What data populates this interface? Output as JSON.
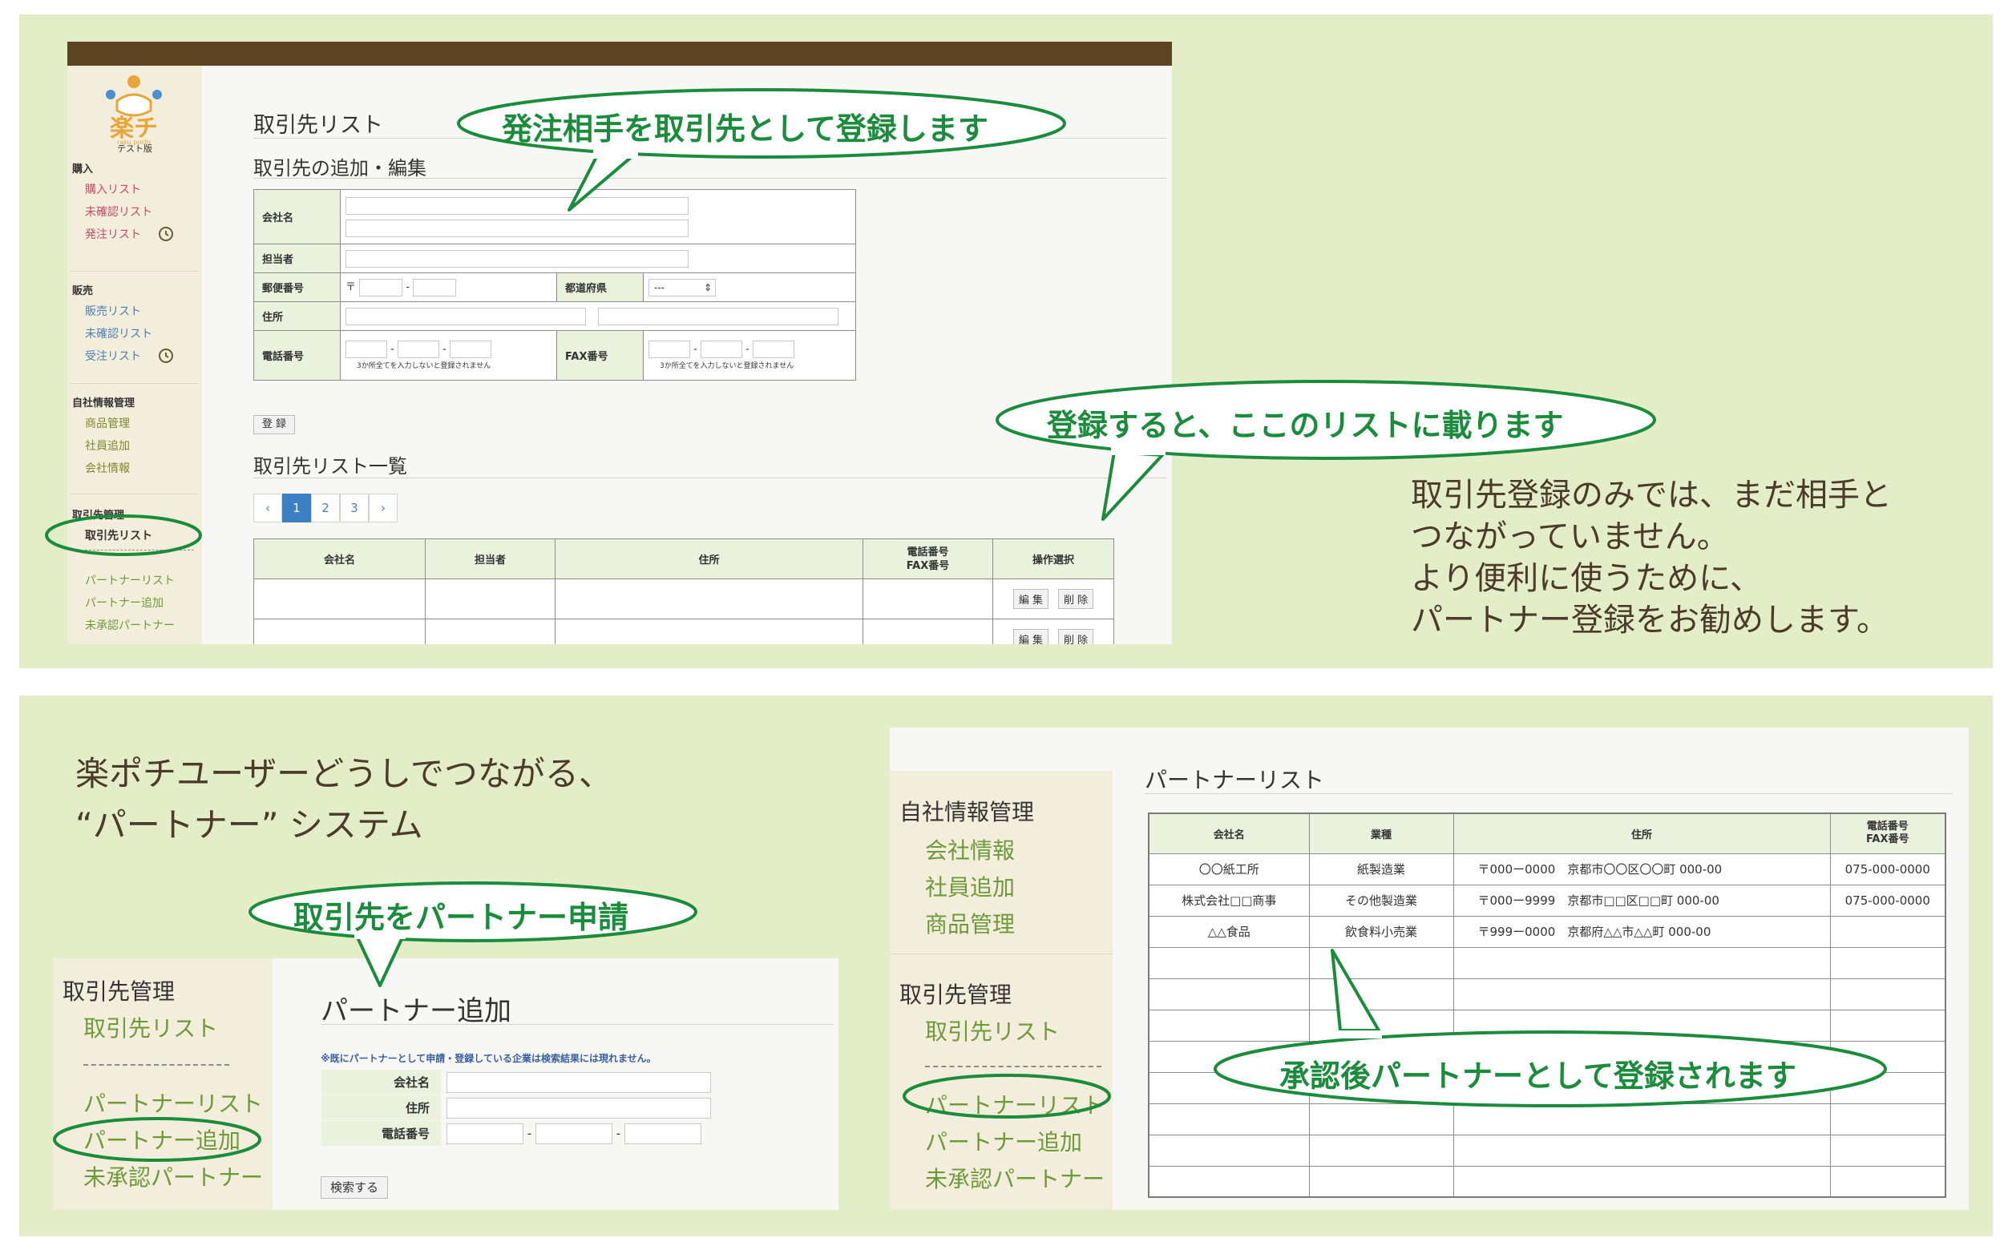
{
  "top_screen": {
    "logo_subtitle": "テスト版",
    "sidebar": [
      {
        "heading": "購入",
        "items": [
          "購入リスト",
          "未確認リスト",
          "発注リスト"
        ]
      },
      {
        "heading": "販売",
        "items": [
          "販売リスト",
          "未確認リスト",
          "受注リスト"
        ]
      },
      {
        "heading": "自社情報管理",
        "items": [
          "商品管理",
          "社員追加",
          "会社情報"
        ]
      },
      {
        "heading": "取引先管理",
        "items": [
          "取引先リスト"
        ]
      },
      {
        "items": [
          "パートナーリスト",
          "パートナー追加",
          "未承認パートナー"
        ]
      }
    ],
    "page_title": "取引先リスト",
    "form_section_title": "取引先の追加・編集",
    "form": {
      "company_label": "会社名",
      "person_label": "担当者",
      "zip_label": "郵便番号",
      "zip_prefix": "〒",
      "dash": "-",
      "prefecture_label": "都道府県",
      "prefecture_value": "---",
      "address_label": "住所",
      "phone_label": "電話番号",
      "fax_label": "FAX番号",
      "phone_note": "3か所全てを入力しないと登録されません",
      "fax_note": "3か所全てを入力しないと登録されません"
    },
    "register_button": "登 録",
    "list_section_title": "取引先リスト一覧",
    "pagination": {
      "prev": "‹",
      "pages": [
        "1",
        "2",
        "3"
      ],
      "next": "›"
    },
    "list_headers": [
      "会社名",
      "担当者",
      "住所",
      "電話番号",
      "FAX番号",
      "操作選択"
    ],
    "edit_button": "編 集",
    "delete_button": "削 除"
  },
  "callouts": {
    "register_partner": "発注相手を取引先として登録します",
    "appears_in_list": "登録すると、ここのリストに載ります",
    "apply_partner": "取引先をパートナー申請",
    "registered_after_approval": "承認後パートナーとして登録されます"
  },
  "description": [
    "取引先登録のみでは、まだ相手と",
    "つながっていません。",
    "より便利に使うために、",
    "パートナー登録をお勧めします。"
  ],
  "intro": [
    "楽ポチユーザーどうしでつながる、",
    "“パートナー” システム"
  ],
  "partner_add_screen": {
    "sidebar_heading": "取引先管理",
    "sidebar_items": [
      "取引先リスト",
      "パートナーリスト",
      "パートナー追加",
      "未承認パートナー"
    ],
    "title": "パートナー追加",
    "note": "※既にパートナーとして申請・登録している企業は検索結果には現れません。",
    "company_label": "会社名",
    "address_label": "住所",
    "phone_label": "電話番号",
    "dash": "-",
    "search_button": "検索する"
  },
  "partner_list_screen": {
    "sidebar": [
      {
        "heading": "自社情報管理",
        "items": [
          "会社情報",
          "社員追加",
          "商品管理"
        ]
      },
      {
        "heading": "取引先管理",
        "items": [
          "取引先リスト",
          "パートナーリスト",
          "パートナー追加",
          "未承認パートナー"
        ]
      }
    ],
    "title": "パートナーリスト",
    "headers": [
      "会社名",
      "業種",
      "住所",
      "電話番号",
      "FAX番号"
    ],
    "rows": [
      {
        "company": "〇〇紙工所",
        "industry": "紙製造業",
        "zip": "〒000ー0000",
        "address": "京都市〇〇区〇〇町 000-00",
        "phone": "075-000-0000"
      },
      {
        "company": "株式会社□□商事",
        "industry": "その他製造業",
        "zip": "〒000ー9999",
        "address": "京都市□□区□□町 000-00",
        "phone": "075-000-0000"
      },
      {
        "company": "△△食品",
        "industry": "飲食料小売業",
        "zip": "〒999ー0000",
        "address": "京都府△△市△△町 000-00",
        "phone": ""
      }
    ]
  },
  "colors": {
    "panel": "#e3edc7",
    "callout": "#1a8c3c",
    "topbar": "#5c4322",
    "sidebar": "#f3eddb"
  }
}
